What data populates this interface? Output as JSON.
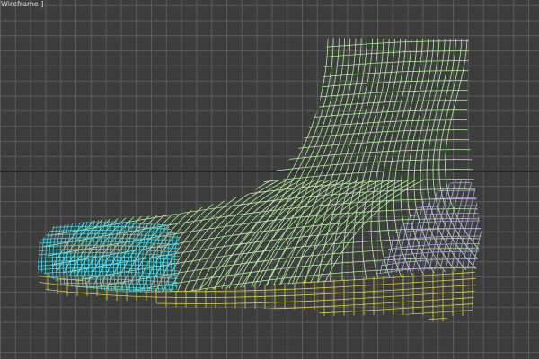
{
  "viewport": {
    "label": "Wireframe ]",
    "shading_mode": "wireframe",
    "colors": {
      "background": "#3d3d3d",
      "grid": "#5c5c5c",
      "axis": "#1e1e1e",
      "upper": "#b4f0a0",
      "toe_cap": "#46d2e6",
      "heel_counter": "#b4a6ea",
      "sole": "#d6cf44"
    },
    "objects": [
      "boot-upper",
      "boot-toe-cap",
      "boot-heel-counter",
      "boot-sole"
    ]
  }
}
